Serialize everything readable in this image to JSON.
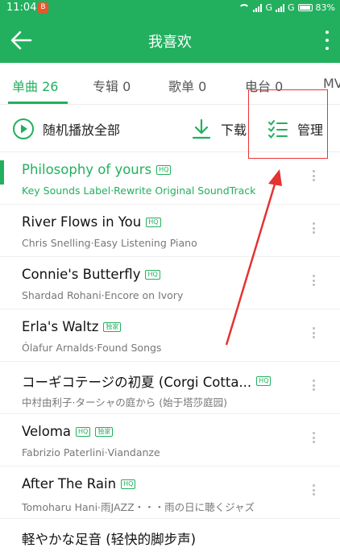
{
  "status": {
    "time": "11:04",
    "notif": "B",
    "signal_text": "G",
    "signal_text2": "G",
    "battery": "83%"
  },
  "header": {
    "title": "我喜欢"
  },
  "tabs": [
    {
      "label": "单曲 26"
    },
    {
      "label": "专辑 0"
    },
    {
      "label": "歌单 0"
    },
    {
      "label": "电台 0"
    },
    {
      "label": "MV"
    }
  ],
  "actions": {
    "shuffle": "随机播放全部",
    "download": "下载",
    "manage": "管理"
  },
  "badges": {
    "hq": "HQ",
    "exclusive": "独家"
  },
  "songs": [
    {
      "title": "Philosophy of yours",
      "sub": "Key Sounds Label·Rewrite Original SoundTrack"
    },
    {
      "title": "River Flows in You",
      "sub": "Chris Snelling·Easy Listening Piano"
    },
    {
      "title": "Connie's Butterfly",
      "sub": "Shardad Rohani·Encore on Ivory"
    },
    {
      "title": "Erla's Waltz",
      "sub": "Ólafur Arnalds·Found Songs"
    },
    {
      "title": "コーギコテージの初夏 (Corgi Cotta...",
      "sub": "中村由利子·ターシャの庭から (始于塔莎庭园)"
    },
    {
      "title": "Veloma",
      "sub": "Fabrizio Paterlini·Viandanze"
    },
    {
      "title": "After The Rain",
      "sub": "Tomoharu Hani·雨JAZZ・・・雨の日に聴くジャズ"
    },
    {
      "title": "軽やかな足音 (轻快的脚步声)",
      "sub": ""
    }
  ],
  "colors": {
    "brand": "#22b05e",
    "annotation": "#e33333"
  }
}
